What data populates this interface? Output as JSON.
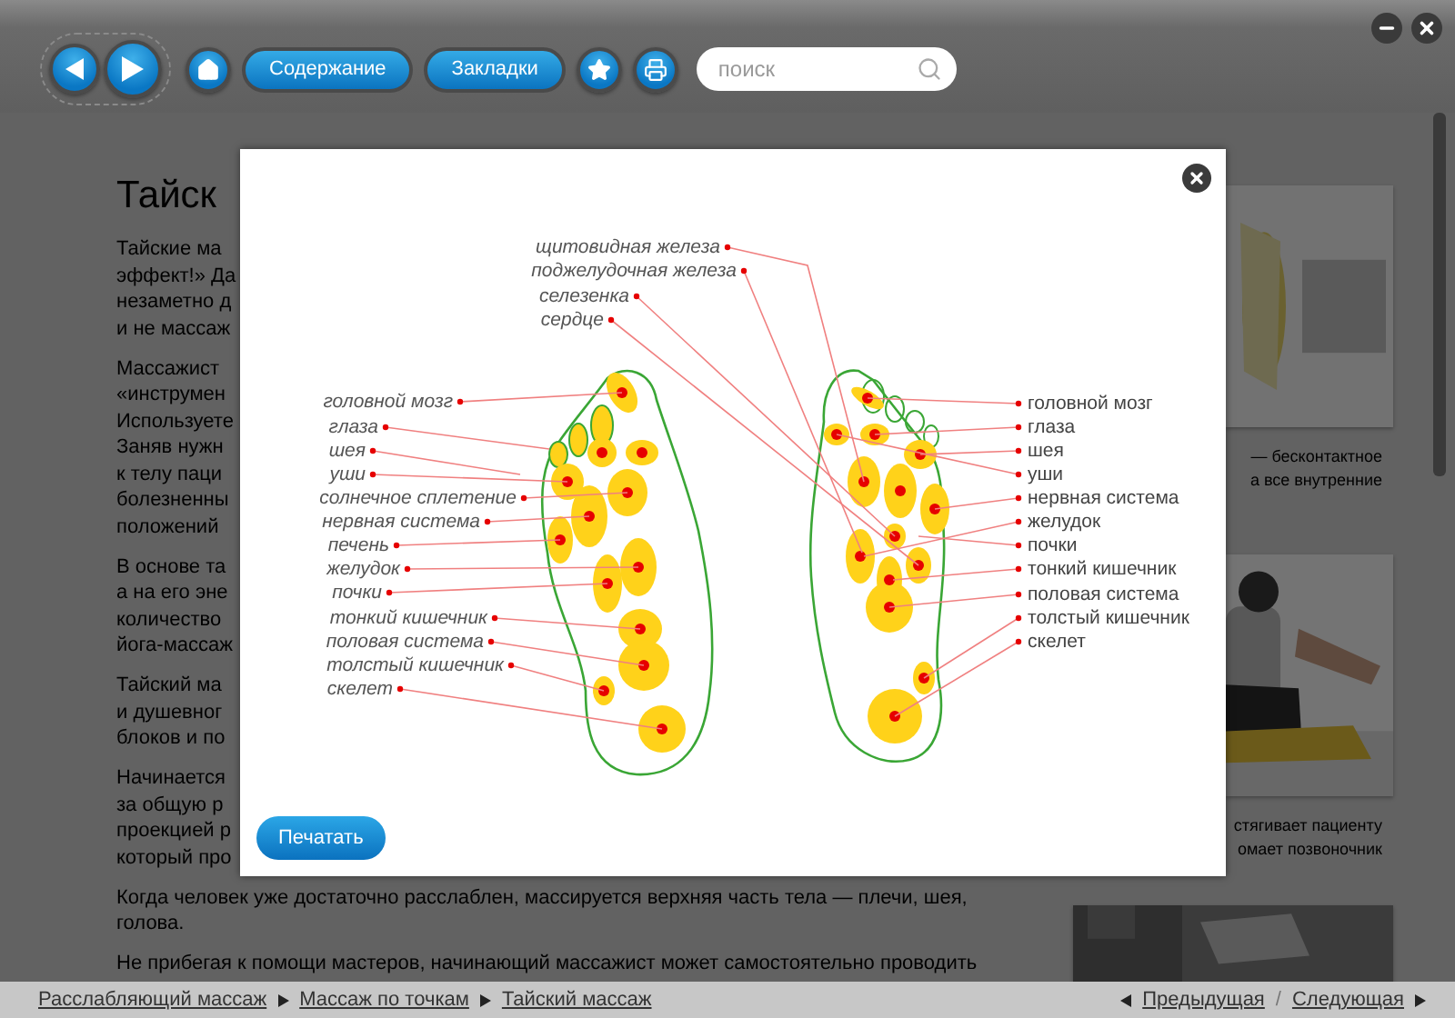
{
  "toolbar": {
    "buttons": [
      {
        "label": "Содержание"
      },
      {
        "label": "Закладки"
      }
    ],
    "search": {
      "placeholder": "поиск"
    }
  },
  "article": {
    "heading": "Тайск",
    "paragraphs": [
      [
        "Тайские ма",
        "эффект!» Да",
        "незаметно д",
        "и не массаж"
      ],
      [
        "Массажист",
        "«инструмен",
        "Используете",
        "Заняв нужн",
        "к телу паци",
        "болезненны",
        "положений"
      ],
      [
        "В основе та",
        "а на его эне",
        "количество",
        "йога-массаж"
      ],
      [
        "Тайский ма",
        "и душевног",
        "блоков и по"
      ],
      [
        "Начинается",
        "за общую р",
        "проекцией р",
        "который про"
      ]
    ],
    "full_paragraphs": [
      [
        "Когда человек уже достаточно расслаблен, массируется верхняя часть тела — плечи, шея,",
        "голова."
      ],
      [
        "Не прибегая к помощи мастеров, начинающий массажист может самостоятельно проводить"
      ]
    ]
  },
  "sidebar": {
    "captions": [
      [
        "— бесконтактное",
        "а все внутренние"
      ],
      [
        "стягивает пациенту",
        "омает позвоночник"
      ]
    ]
  },
  "modal": {
    "diagram": {
      "top_labels": [
        "щитовидная железа",
        "поджелудочная железа",
        "селезенка",
        "сердце"
      ],
      "left_labels": [
        "головной мозг",
        "глаза",
        "шея",
        "уши",
        "солнечное сплетение",
        "нервная система",
        "печень",
        "желудок",
        "почки",
        "тонкий кишечник",
        "половая система",
        "толстый кишечник",
        "скелет"
      ],
      "right_labels": [
        "головной мозг",
        "глаза",
        "шея",
        "уши",
        "нервная система",
        "желудок",
        "почки",
        "тонкий кишечник",
        "половая система",
        "толстый кишечник",
        "скелет"
      ]
    },
    "print_button": "Печатать"
  },
  "breadcrumbs": [
    "Расслабляющий массаж",
    "Массаж по точкам",
    "Тайский массаж"
  ],
  "pager": {
    "previous": "Предыдущая",
    "separator": "/",
    "next": "Следующая"
  }
}
